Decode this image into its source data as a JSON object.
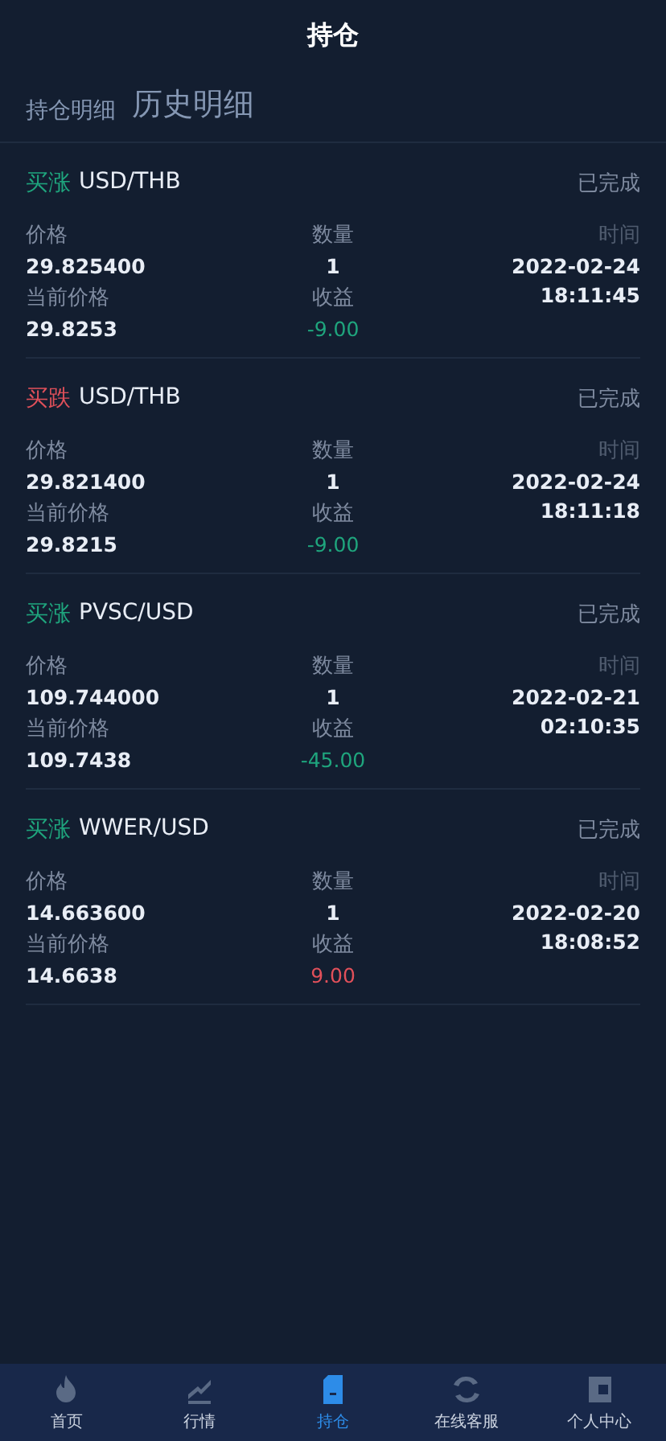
{
  "header": {
    "title": "持仓"
  },
  "tabs": [
    {
      "label": "持仓明细",
      "selected": false
    },
    {
      "label": "历史明细",
      "selected": true
    }
  ],
  "orders": [
    {
      "side": {
        "label": "买涨",
        "kind": "up"
      },
      "pair": "USD/THB",
      "status": "已完成",
      "price_label": "价格",
      "price": "29.825400",
      "qty_label": "数量",
      "qty": "1",
      "time_label": "时间",
      "date": "2022-02-24",
      "time": "18:11:45",
      "current_label": "当前价格",
      "current": "29.8253",
      "profit_label": "收益",
      "profit": {
        "value": "-9.00",
        "kind": "green"
      }
    },
    {
      "side": {
        "label": "买跌",
        "kind": "down"
      },
      "pair": "USD/THB",
      "status": "已完成",
      "price_label": "价格",
      "price": "29.821400",
      "qty_label": "数量",
      "qty": "1",
      "time_label": "时间",
      "date": "2022-02-24",
      "time": "18:11:18",
      "current_label": "当前价格",
      "current": "29.8215",
      "profit_label": "收益",
      "profit": {
        "value": "-9.00",
        "kind": "green"
      }
    },
    {
      "side": {
        "label": "买涨",
        "kind": "up"
      },
      "pair": "PVSC/USD",
      "status": "已完成",
      "price_label": "价格",
      "price": "109.744000",
      "qty_label": "数量",
      "qty": "1",
      "time_label": "时间",
      "date": "2022-02-21",
      "time": "02:10:35",
      "current_label": "当前价格",
      "current": "109.7438",
      "profit_label": "收益",
      "profit": {
        "value": "-45.00",
        "kind": "green"
      }
    },
    {
      "side": {
        "label": "买涨",
        "kind": "up"
      },
      "pair": "WWER/USD",
      "status": "已完成",
      "price_label": "价格",
      "price": "14.663600",
      "qty_label": "数量",
      "qty": "1",
      "time_label": "时间",
      "date": "2022-02-20",
      "time": "18:08:52",
      "current_label": "当前价格",
      "current": "14.6638",
      "profit_label": "收益",
      "profit": {
        "value": "9.00",
        "kind": "red"
      }
    }
  ],
  "nav": [
    {
      "label": "首页",
      "selected": false
    },
    {
      "label": "行情",
      "selected": false
    },
    {
      "label": "持仓",
      "selected": true
    },
    {
      "label": "在线客服",
      "selected": false
    },
    {
      "label": "个人中心",
      "selected": false
    }
  ]
}
